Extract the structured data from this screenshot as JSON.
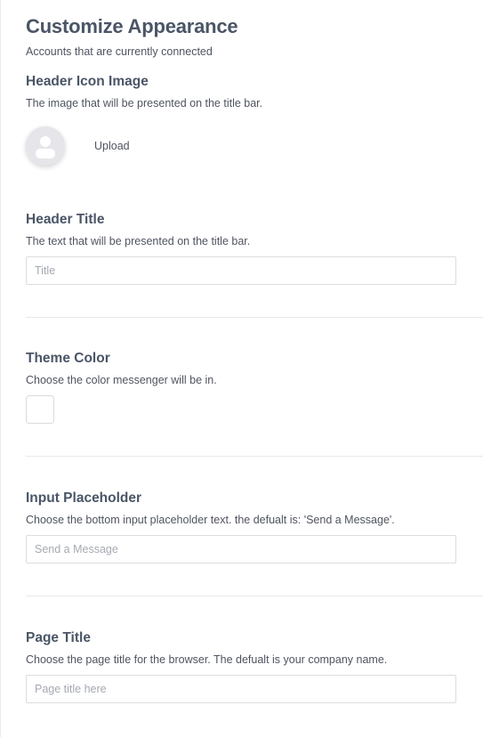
{
  "header": {
    "title": "Customize Appearance",
    "subtitle": "Accounts that are currently connected"
  },
  "sections": {
    "header_icon": {
      "title": "Header Icon Image",
      "description": "The image that will be presented on the title bar.",
      "avatar_icon": "user-avatar-icon",
      "upload_label": "Upload"
    },
    "header_title": {
      "title": "Header Title",
      "description": "The text that will be presented on the title bar.",
      "value": "",
      "placeholder": "Title"
    },
    "theme_color": {
      "title": "Theme Color",
      "description": "Choose the color messenger will be in.",
      "color": "#ffffff"
    },
    "input_placeholder": {
      "title": "Input Placeholder",
      "description": "Choose the bottom input placeholder text. the defualt is: 'Send a Message'.",
      "value": "",
      "placeholder": "Send a Message"
    },
    "page_title": {
      "title": "Page Title",
      "description": "Choose the page title for the browser. The defualt is your company name.",
      "value": "",
      "placeholder": "Page title here"
    }
  }
}
